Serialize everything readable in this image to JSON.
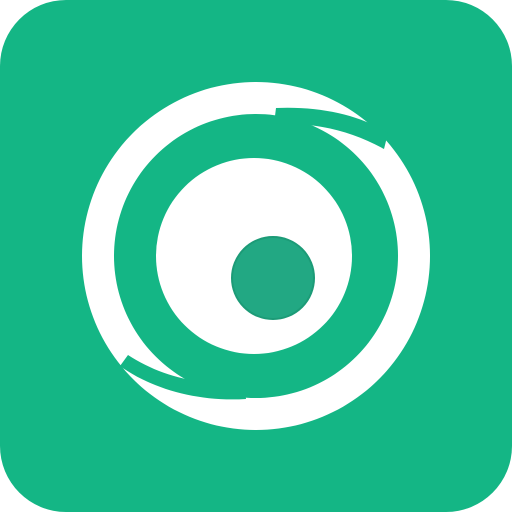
{
  "icon": {
    "name": "swirl-eye-app-icon",
    "colors": {
      "background": "#14b685",
      "ring": "#ffffff",
      "lens": "#ffffff",
      "pupil": "#22a883",
      "pupil_outline": "#1c9b77"
    }
  }
}
